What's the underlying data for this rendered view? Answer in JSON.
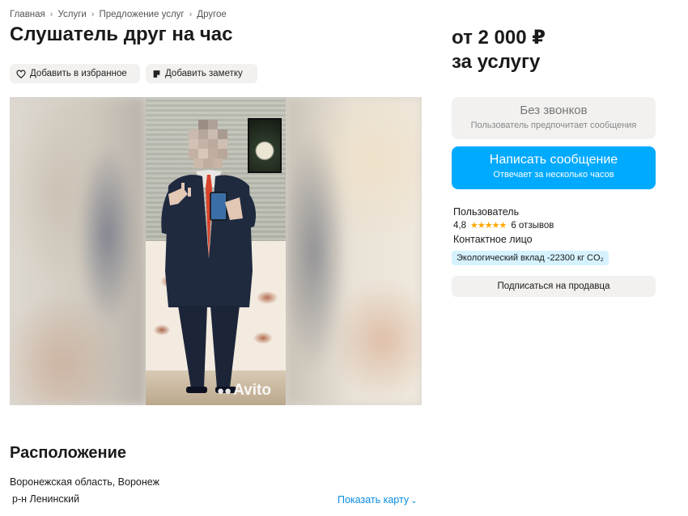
{
  "breadcrumb": {
    "items": [
      "Главная",
      "Услуги",
      "Предложение услуг",
      "Другое"
    ],
    "separator": "›"
  },
  "listing": {
    "title": "Слушатель друг на час",
    "actions": {
      "favorite_label": "Добавить в избранное",
      "note_label": "Добавить заметку"
    },
    "photo": {
      "watermark": "Avito"
    }
  },
  "pricing": {
    "line1": "от 2 000 ₽",
    "line2": "за услугу"
  },
  "contact_panel": {
    "no_calls_title": "Без звонков",
    "no_calls_subtitle": "Пользователь предпочитает сообщения",
    "message_button_title": "Написать сообщение",
    "message_button_subtitle": "Отвечает за несколько часов"
  },
  "seller": {
    "name": "Пользователь",
    "rating": "4,8",
    "stars": "★★★★★",
    "reviews": "6 отзывов",
    "role": "Контактное лицо",
    "eco_badge": "Экологический вклад -22300 кг CO₂",
    "subscribe_label": "Подписаться на продавца"
  },
  "location": {
    "title": "Расположение",
    "line1": "Воронежская область, Воронеж",
    "line2": "р-н Ленинский",
    "show_map_label": "Показать карту"
  },
  "colors": {
    "accent": "#00aaff",
    "link": "#0a8be0",
    "star": "#ffa800",
    "pill_bg": "#f2f1f0",
    "eco_bg": "#d6f2ff"
  },
  "icons": {
    "favorite": "heart-icon",
    "note": "note-icon",
    "map_chevron": "chevron-down-icon"
  }
}
